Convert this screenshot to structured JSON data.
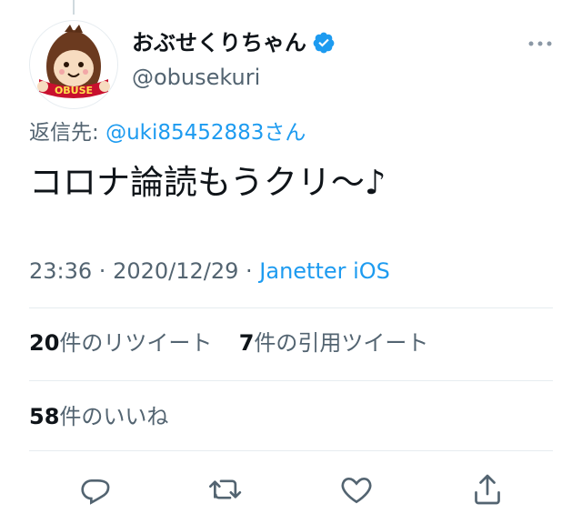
{
  "tweet": {
    "display_name": "おぶせくりちゃん",
    "handle": "@obusekuri",
    "avatar_label": "OBUSE",
    "reply_prefix": "返信先: ",
    "reply_mention": "@uki85452883",
    "reply_suffix": "さん",
    "text": "コロナ論読もうクリ〜♪",
    "time": "23:36",
    "separator": " · ",
    "date": "2020/12/29",
    "source": "Janetter iOS"
  },
  "stats": {
    "retweets_count": "20",
    "retweets_label": "件のリツイート",
    "quotes_count": "7",
    "quotes_label": "件の引用ツイート",
    "likes_count": "58",
    "likes_label": "件のいいね"
  },
  "colors": {
    "accent": "#1d9bf0",
    "text_primary": "#0f1419",
    "text_secondary": "#536471",
    "divider": "#e6ecf0"
  },
  "icons": {
    "verified": "verified-badge-icon",
    "more": "more-horizontal-icon",
    "reply": "reply-icon",
    "retweet": "retweet-icon",
    "like": "heart-icon",
    "share": "share-icon"
  }
}
